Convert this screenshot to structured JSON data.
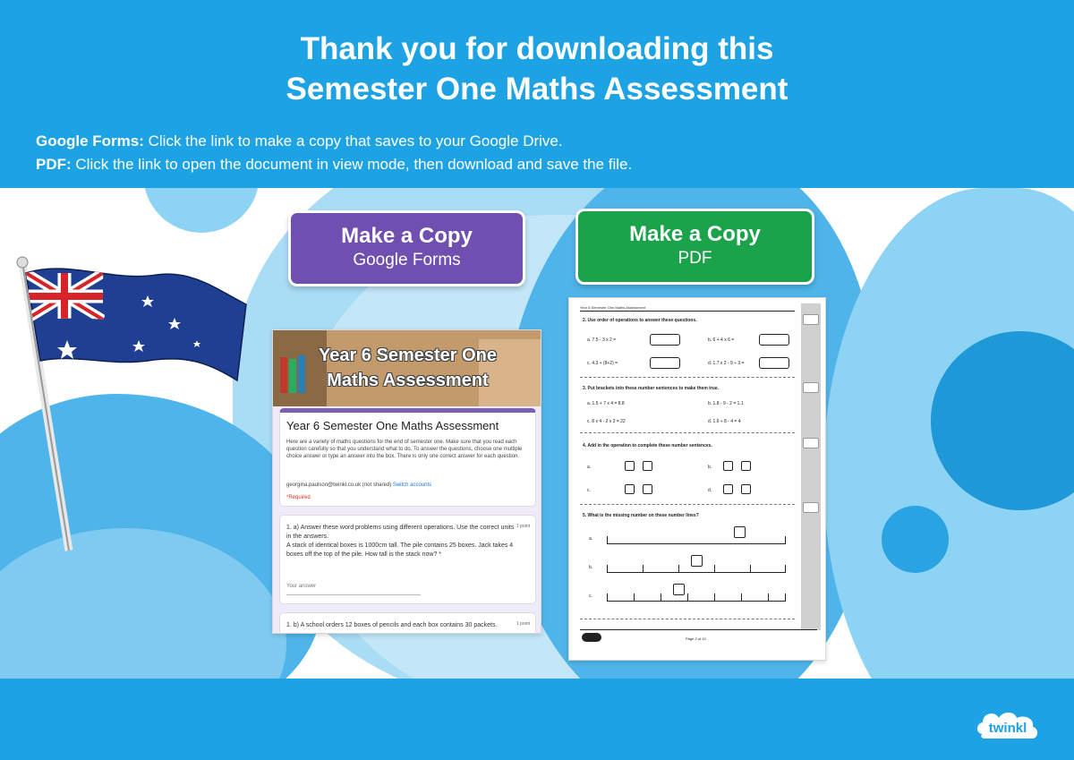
{
  "header": {
    "title_line1": "Thank you for downloading this",
    "title_line2": "Semester One Maths Assessment"
  },
  "info": {
    "gforms_label": "Google Forms:",
    "gforms_text": " Click the link to make a copy that saves to your Google Drive.",
    "pdf_label": "PDF:",
    "pdf_text": " Click the link to open the document in view mode, then download and save the file."
  },
  "buttons": {
    "gforms": {
      "title": "Make a Copy",
      "sub": "Google Forms",
      "color": "#6f4fb0"
    },
    "pdf": {
      "title": "Make a Copy",
      "sub": "PDF",
      "color": "#1aa34a"
    }
  },
  "gforms_preview": {
    "banner_line1": "Year 6 Semester One",
    "banner_line2": "Maths Assessment",
    "form_title": "Year 6 Semester One Maths Assessment",
    "form_desc": "Here are a variety of maths questions for the end of semester one. Make sure that you read each question carefully so that you understand what to do. To answer the questions, choose one multiple choice answer or type an answer into the box. There is only one correct answer for each question.",
    "email": "georgina.paulson@twinkl.co.uk",
    "email_status": " (not shared) ",
    "switch": "Switch accounts",
    "required": "*Required",
    "q1": "1. a) Answer these word problems using different operations. Use the correct units in the answers.",
    "q1b": "A stack of identical boxes is 1000cm tall. The pile contains 25 boxes. Jack takes 4 boxes off the top of the pile. How tall is the stack now? *",
    "q1_points": "1 point",
    "answer_placeholder": "Your answer",
    "q2": "1. b) A school orders 12 boxes of pencils and each box contains 30 packets.",
    "q2_points": "1 point"
  },
  "pdf_preview": {
    "header": "Year 6 Semester One Maths Assessment",
    "q2": "2.  Use order of operations to answer these questions.",
    "q2a": "a.     7.5 - 3 x 2 =",
    "q2b": "b.     6 + 4 x 6 =",
    "q2c": "c.     4.3 + (8+2) =",
    "q2d": "d.     1.7 x 2 - 9 ÷ 3 =",
    "q3": "3.  Put brackets into these number sentences to make them true.",
    "q3a": "a.     1.5 + 7 x 4 = 8.8",
    "q3b": "b.     1.8 - 9 - 2 = 1.1",
    "q3c": "c.     8 x 4 - 2 x 3 = 22",
    "q3d": "d.     1.6 ÷ 8 - 4 = 4",
    "q4": "4.  Add in the operation to complete these number sentences.",
    "q4a": "a.",
    "q4b": "b.",
    "q4c": "c.",
    "q4d": "d.",
    "q5": "5.  What is the missing number on these number lines?",
    "q5a": "a.",
    "q5b": "b.",
    "q5c": "c.",
    "footer_page": "Page 2 of 10"
  },
  "brand": {
    "logo_text": "twinkl"
  },
  "colors": {
    "header_blue": "#1da2e4",
    "light_blue": "#8dd3f4"
  }
}
